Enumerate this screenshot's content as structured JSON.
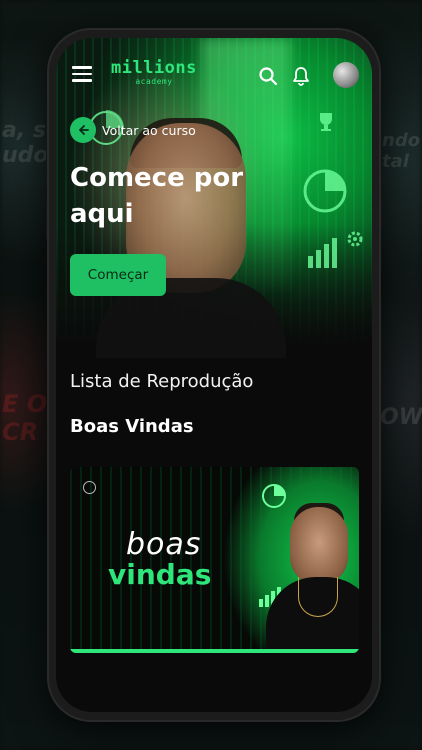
{
  "header": {
    "logo_main": "millions",
    "logo_sub": "academy",
    "icons": [
      "menu-icon",
      "search-icon",
      "bell-icon",
      "avatar"
    ]
  },
  "hero": {
    "back_label": "Voltar ao curso",
    "title_line1": "Comece por",
    "title_line2": "aqui",
    "start_button": "Começar"
  },
  "playlist": {
    "section_title": "Lista de Reprodução",
    "name": "Boas Vindas",
    "videos": [
      {
        "thumb_line1": "boas",
        "thumb_line2": "vindas"
      }
    ]
  },
  "colors": {
    "accent": "#1fbf63",
    "logo_green": "#2ee67a",
    "background": "#0a0a0a"
  }
}
